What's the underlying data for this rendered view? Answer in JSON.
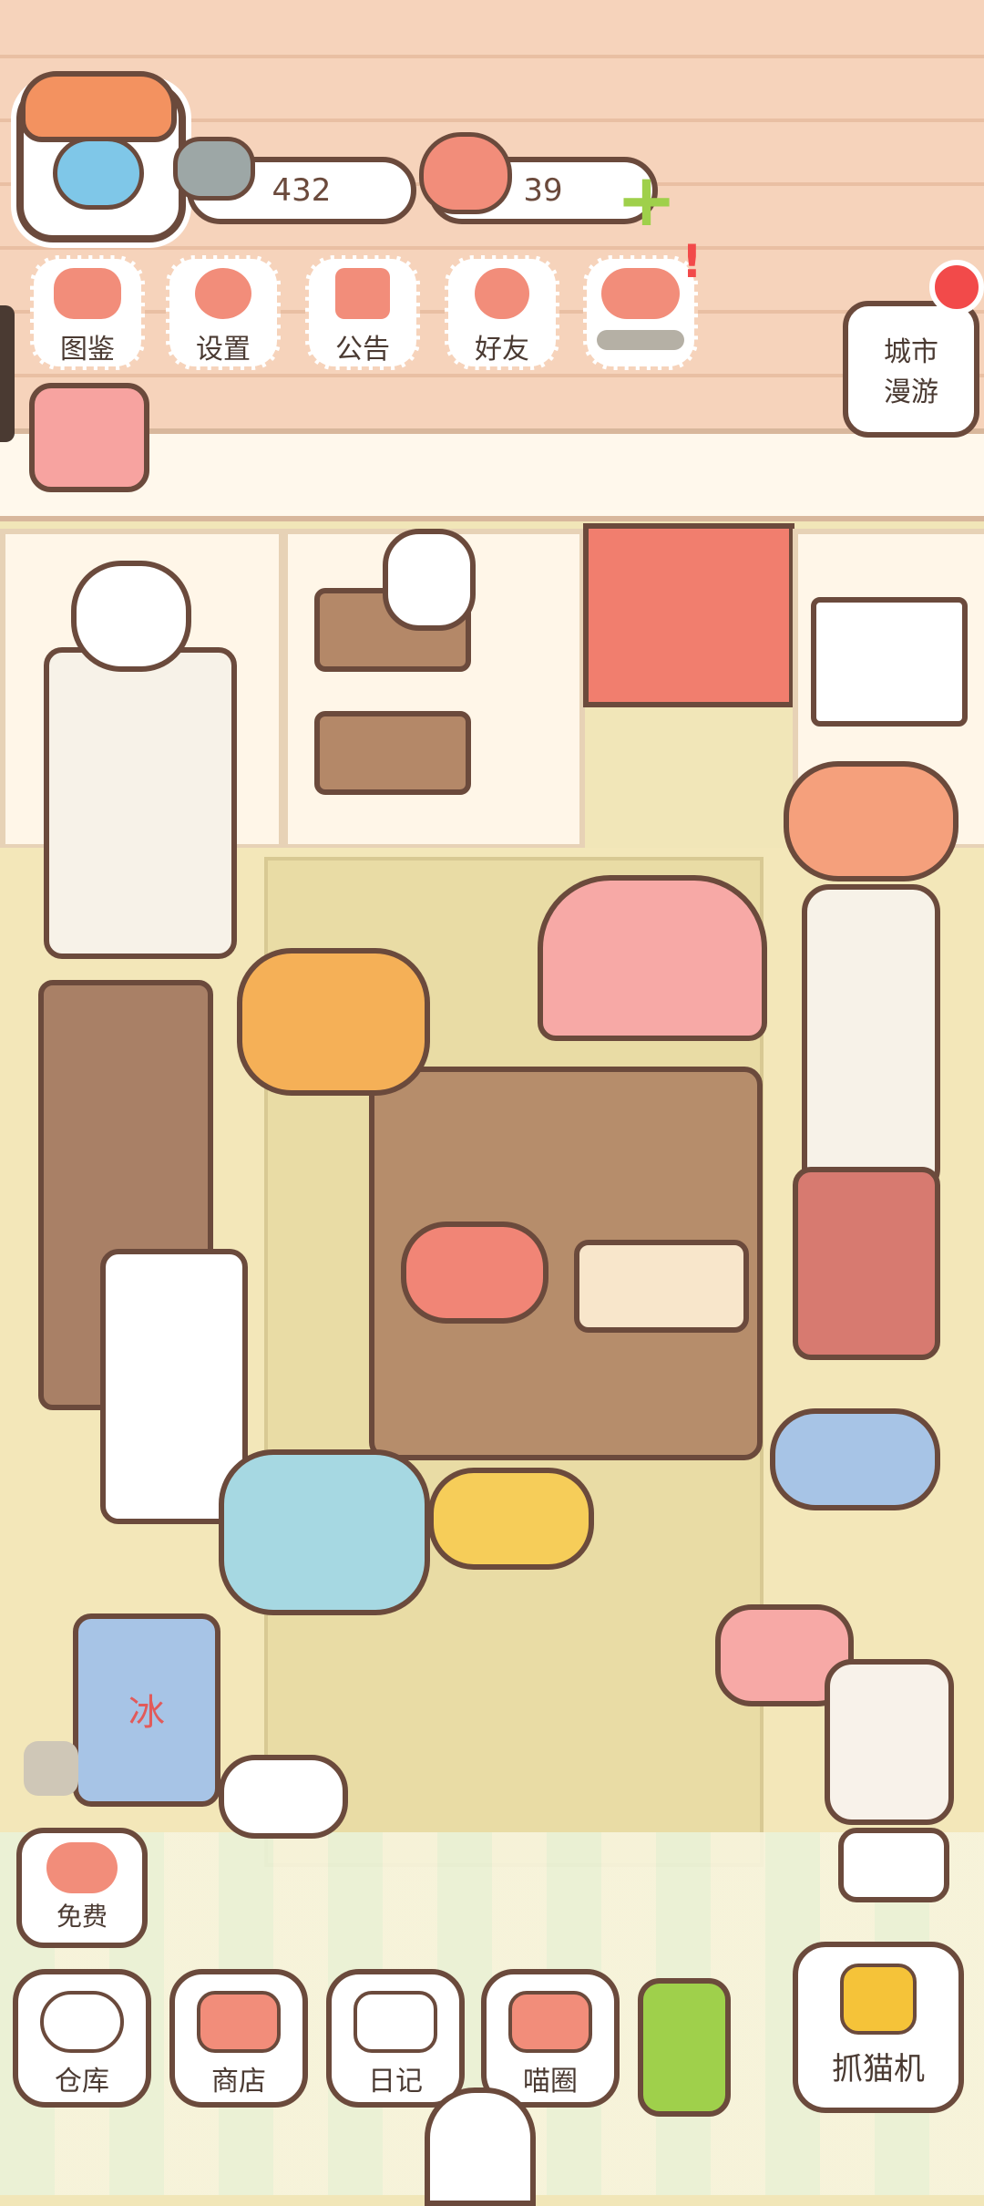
{
  "hud": {
    "fish_count": "432",
    "heart_count": "39",
    "plus_symbol": "+",
    "alert_mark": "!"
  },
  "menu": {
    "items": [
      {
        "label": "图鉴",
        "icon": "cat-book-icon"
      },
      {
        "label": "设置",
        "icon": "gear-icon"
      },
      {
        "label": "公告",
        "icon": "gift-icon"
      },
      {
        "label": "好友",
        "icon": "friends-icon"
      },
      {
        "label": "",
        "icon": "heart-events-icon"
      }
    ]
  },
  "city_tour": {
    "label_line1": "城市",
    "label_line2": "漫游"
  },
  "free": {
    "label": "免费"
  },
  "bottom_nav": {
    "items": [
      {
        "label": "仓库",
        "icon": "warehouse-icon"
      },
      {
        "label": "商店",
        "icon": "shop-icon"
      },
      {
        "label": "日记",
        "icon": "diary-icon"
      },
      {
        "label": "喵圈",
        "icon": "cat-planet-icon"
      }
    ],
    "claw": {
      "label": "抓猫机",
      "icon": "claw-machine-icon"
    }
  },
  "scene": {
    "ice_sign": "冰"
  },
  "colors": {
    "outline": "#6b4a3c",
    "accent_pink": "#f28d7a",
    "wall": "#f6d3bb",
    "floor": "#f3e7b9",
    "green_plus": "#9fd04b",
    "alert_red": "#f24a4a"
  }
}
